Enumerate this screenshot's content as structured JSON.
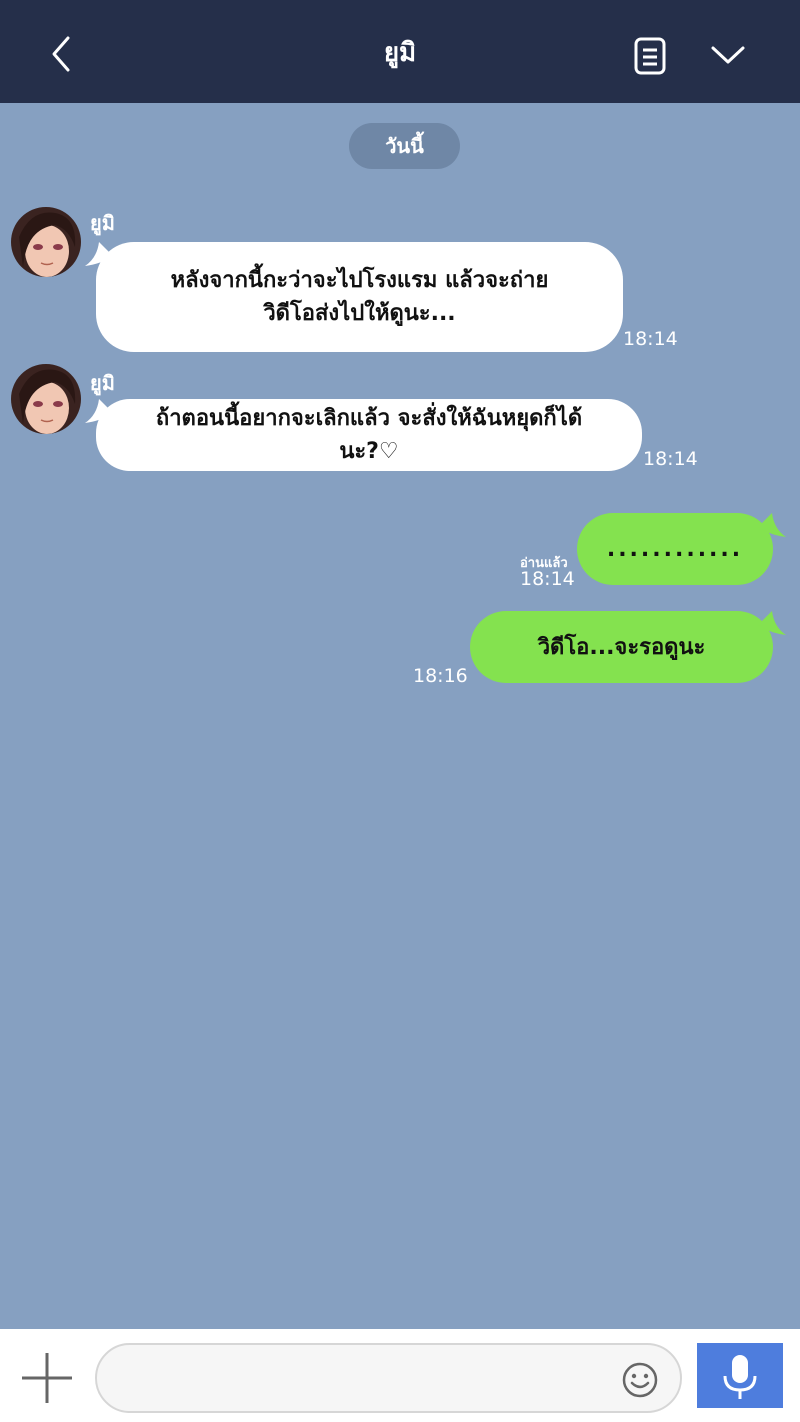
{
  "header": {
    "title": "ยูมิ",
    "back_icon": "chevron-left-icon",
    "notes_icon": "notes-icon",
    "menu_icon": "chevron-down-icon"
  },
  "date_divider": "วันนี้",
  "messages": [
    {
      "direction": "incoming",
      "sender": "ยูมิ",
      "lines": [
        "หลังจากนี้กะว่าจะไปโรงแรม แล้วจะถ่าย",
        "วิดีโอส่งไปให้ดูนะ..."
      ],
      "time": "18:14"
    },
    {
      "direction": "incoming",
      "sender": "ยูมิ",
      "lines": [
        "ถ้าตอนนี้อยากจะเลิกแล้ว จะสั่งให้ฉันหยุดก็ได้",
        "นะ?♡"
      ],
      "time": "18:14"
    },
    {
      "direction": "outgoing",
      "text": "............",
      "read": "อ่านแล้ว",
      "time": "18:14"
    },
    {
      "direction": "outgoing",
      "text": "วิดีโอ...จะรอดูนะ",
      "time": "18:16"
    }
  ],
  "input_bar": {
    "placeholder": "",
    "plus_icon": "plus-icon",
    "emoji_icon": "smiley-icon",
    "mic_icon": "microphone-icon"
  },
  "colors": {
    "header_bg": "#252f4a",
    "chat_bg": "#86a0c1",
    "outgoing_bubble": "#84e24f",
    "incoming_bubble": "#ffffff",
    "mic_button": "#4e7ddd"
  }
}
